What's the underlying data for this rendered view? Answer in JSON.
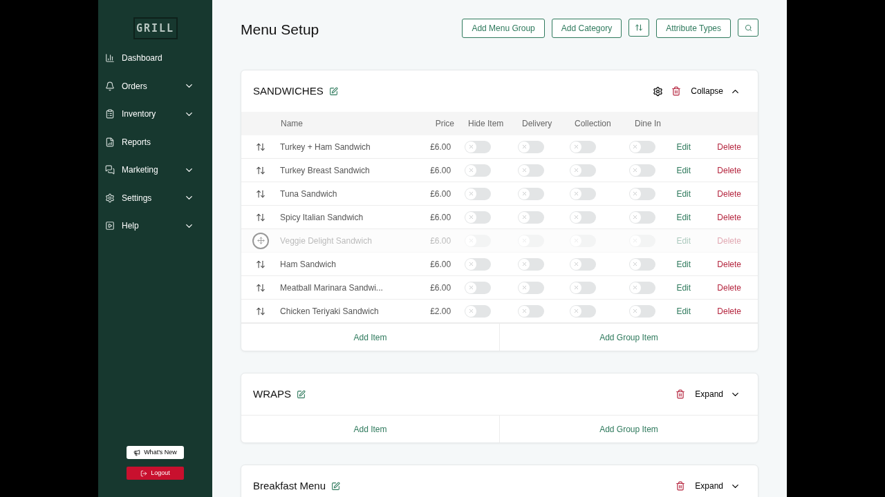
{
  "sidebar": {
    "logo": "GRILL",
    "items": [
      {
        "label": "Dashboard",
        "has_submenu": false
      },
      {
        "label": "Orders",
        "has_submenu": true
      },
      {
        "label": "Inventory",
        "has_submenu": true
      },
      {
        "label": "Reports",
        "has_submenu": false
      },
      {
        "label": "Marketing",
        "has_submenu": true
      },
      {
        "label": "Settings",
        "has_submenu": true
      },
      {
        "label": "Help",
        "has_submenu": true
      }
    ],
    "whats_new": "What's New",
    "logout": "Logout"
  },
  "page": {
    "title": "Menu Setup",
    "actions": [
      {
        "kind": "text",
        "label": "Add Menu Group"
      },
      {
        "kind": "text",
        "label": "Add Category"
      },
      {
        "kind": "sort"
      },
      {
        "kind": "text",
        "label": "Attribute Types"
      },
      {
        "kind": "search"
      }
    ]
  },
  "groups": [
    {
      "name": "SANDWICHES",
      "settings": true,
      "expanded": true,
      "toggle_label": "Collapse",
      "columns": [
        "Name",
        "Price",
        "Hide Item",
        "Delivery",
        "Collection",
        "Dine In"
      ],
      "rows": [
        {
          "name": "Turkey + Ham Sandwich",
          "price": "£6.00",
          "hide": false,
          "delivery": false,
          "collection": false,
          "dine_in": false,
          "dragging": false,
          "edit": "Edit",
          "delete": "Delete"
        },
        {
          "name": "Turkey Breast Sandwich",
          "price": "£6.00",
          "hide": false,
          "delivery": false,
          "collection": false,
          "dine_in": false,
          "dragging": false,
          "edit": "Edit",
          "delete": "Delete"
        },
        {
          "name": "Tuna Sandwich",
          "price": "£6.00",
          "hide": false,
          "delivery": false,
          "collection": false,
          "dine_in": false,
          "dragging": false,
          "edit": "Edit",
          "delete": "Delete"
        },
        {
          "name": "Spicy Italian Sandwich",
          "price": "£6.00",
          "hide": false,
          "delivery": false,
          "collection": false,
          "dine_in": false,
          "dragging": false,
          "edit": "Edit",
          "delete": "Delete"
        },
        {
          "name": "Veggie Delight Sandwich",
          "price": "£6.00",
          "hide": false,
          "delivery": false,
          "collection": false,
          "dine_in": false,
          "dragging": true,
          "edit": "Edit",
          "delete": "Delete"
        },
        {
          "name": "Ham Sandwich",
          "price": "£6.00",
          "hide": false,
          "delivery": false,
          "collection": false,
          "dine_in": false,
          "dragging": false,
          "edit": "Edit",
          "delete": "Delete"
        },
        {
          "name": "Meatball Marinara Sandwi...",
          "price": "£6.00",
          "hide": false,
          "delivery": false,
          "collection": false,
          "dine_in": false,
          "dragging": false,
          "edit": "Edit",
          "delete": "Delete"
        },
        {
          "name": "Chicken Teriyaki Sandwich",
          "price": "£2.00",
          "hide": false,
          "delivery": false,
          "collection": false,
          "dine_in": false,
          "dragging": false,
          "edit": "Edit",
          "delete": "Delete"
        }
      ],
      "footer": [
        "Add Item",
        "Add Group Item"
      ]
    },
    {
      "name": "WRAPS",
      "settings": false,
      "expanded": false,
      "toggle_label": "Expand",
      "footer": [
        "Add Item",
        "Add Group Item"
      ]
    },
    {
      "name": "Breakfast Menu",
      "settings": false,
      "expanded": false,
      "toggle_label": "Expand"
    }
  ]
}
